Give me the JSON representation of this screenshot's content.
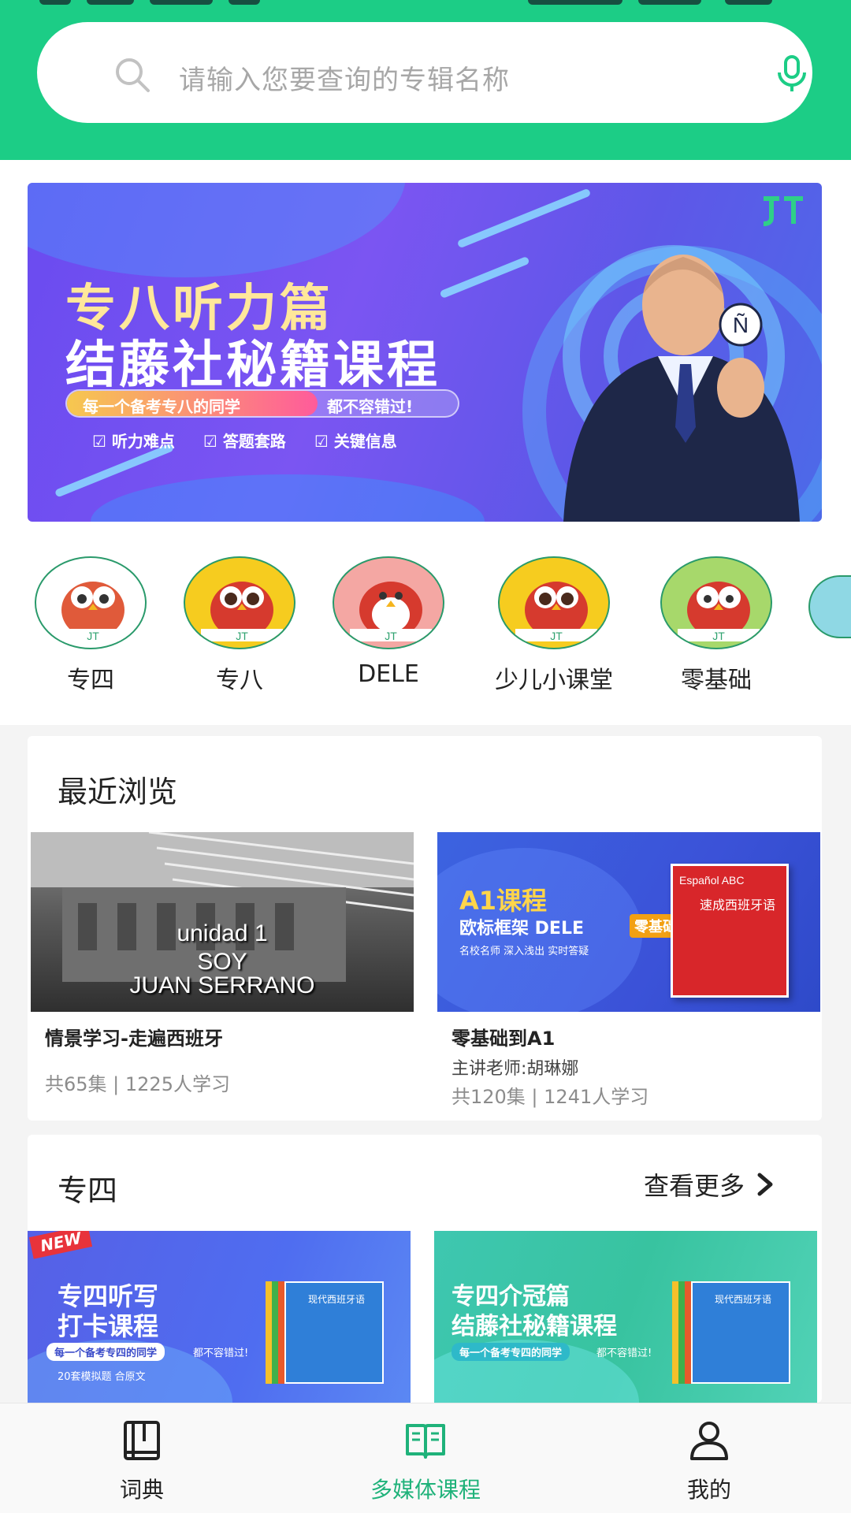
{
  "search": {
    "placeholder": "请输入您要查询的专辑名称"
  },
  "banner": {
    "title_line1": "专八听力篇",
    "title_line2": "结藤社秘籍课程",
    "tagline_a": "每一个备考专八的同学",
    "tagline_b": "都不容错过!",
    "checks": [
      "听力难点",
      "答题套路",
      "关键信息"
    ]
  },
  "categories": [
    {
      "label": "专四"
    },
    {
      "label": "专八"
    },
    {
      "label": "DELE"
    },
    {
      "label": "少儿小课堂"
    },
    {
      "label": "零基础"
    }
  ],
  "recent": {
    "title": "最近浏览",
    "courses": [
      {
        "thumb_text_1": "unidad 1",
        "thumb_text_2": "SOY",
        "thumb_text_3": "JUAN SERRANO",
        "title": "情景学习-走遍西班牙",
        "meta": "共65集 | 1225人学习"
      },
      {
        "thumb_title": "A1课程",
        "thumb_sub": "欧标框架 DELE",
        "thumb_tag": "零基础",
        "thumb_points": "名校名师  深入浅出  实时答疑",
        "book_title": "Español ABC",
        "book_sub": "速成西班牙语",
        "title": "零基础到A1",
        "teacher": "主讲老师:胡琳娜",
        "meta": "共120集 | 1241人学习"
      }
    ]
  },
  "zhuansi": {
    "title": "专四",
    "more_label": "查看更多",
    "cards": [
      {
        "badge": "NEW",
        "line1": "专四听写",
        "line2": "打卡课程",
        "tag_a": "每一个备考专四的同学",
        "tag_b": "都不容错过!",
        "bullets": "20套模拟题  合原文",
        "book": "现代西班牙语"
      },
      {
        "line1": "专四介冠篇",
        "line2": "结藤社秘籍课程",
        "tag_a": "每一个备考专四的同学",
        "tag_b": "都不容错过!",
        "book": "现代西班牙语"
      }
    ]
  },
  "nav": {
    "items": [
      {
        "label": "词典",
        "active": false
      },
      {
        "label": "多媒体课程",
        "active": true
      },
      {
        "label": "我的",
        "active": false
      }
    ]
  },
  "colors": {
    "brand": "#1ccd86",
    "active_nav": "#1fb27a",
    "inactive_nav": "#222222"
  }
}
